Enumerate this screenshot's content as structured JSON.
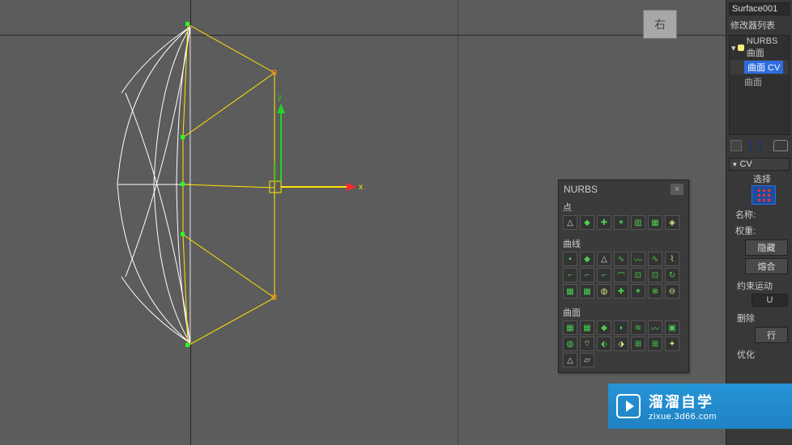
{
  "viewport": {
    "cube_label": "右",
    "gizmo": {
      "x_label": "x",
      "y_label": "y"
    }
  },
  "object_name": "Surface001",
  "modifier_list_label": "修改器列表",
  "modifiers": {
    "top": "NURBS 曲面",
    "sub_selected": "曲面 CV",
    "sub2": "曲面"
  },
  "nurbs_toolbox": {
    "title": "NURBS",
    "groups": {
      "points": "点",
      "curves": "曲线",
      "surfaces": "曲面"
    }
  },
  "cv_section": {
    "title": "CV",
    "select_label": "选择",
    "name_label": "名称:",
    "weight_label": "权重:",
    "hide_btn": "隐藏",
    "fuse_btn": "熔合",
    "constrain_label": "约束运动",
    "u_label": "U",
    "delete_label": "删除",
    "row_btn": "行",
    "optimize_label": "优化"
  },
  "watermark": {
    "brand": "溜溜自学",
    "url": "zixue.3d66.com"
  }
}
